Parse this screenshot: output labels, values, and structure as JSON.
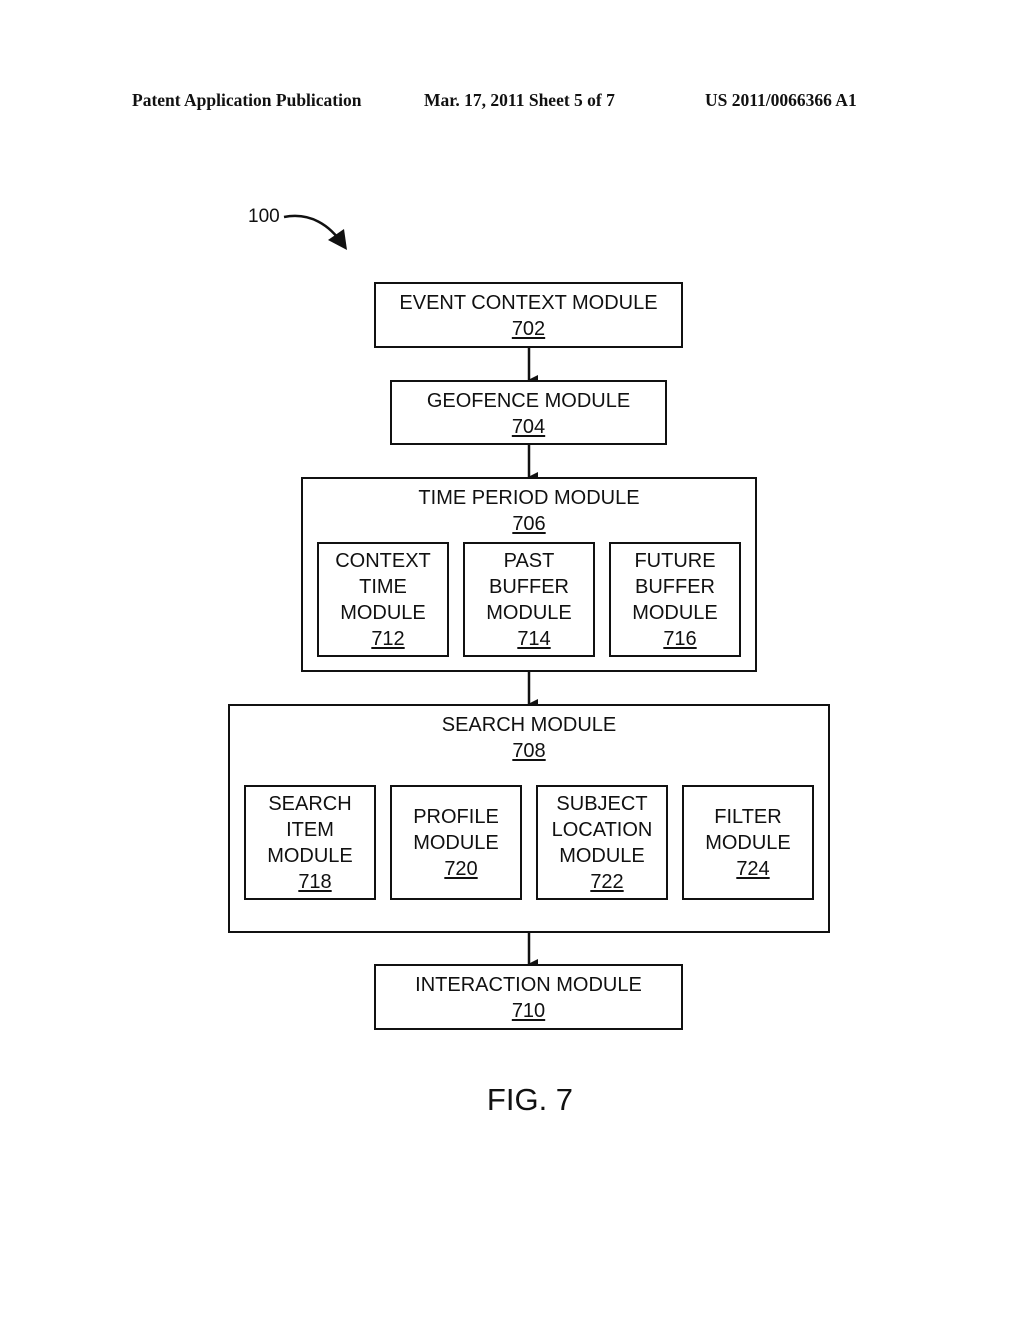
{
  "header": {
    "publication": "Patent Application Publication",
    "date_sheet": "Mar. 17, 2011  Sheet 5 of 7",
    "number": "US 2011/0066366 A1"
  },
  "diagram": {
    "reference": "100",
    "figure_label": "FIG. 7",
    "modules": {
      "event_context": {
        "label": "EVENT CONTEXT MODULE",
        "ref": "702"
      },
      "geofence": {
        "label": "GEOFENCE MODULE",
        "ref": "704"
      },
      "time_period": {
        "label": "TIME PERIOD MODULE",
        "ref": "706",
        "children": [
          {
            "label": "CONTEXT\nTIME\nMODULE",
            "ref": "712"
          },
          {
            "label": "PAST\nBUFFER\nMODULE",
            "ref": "714"
          },
          {
            "label": "FUTURE\nBUFFER\nMODULE",
            "ref": "716"
          }
        ]
      },
      "search": {
        "label": "SEARCH MODULE",
        "ref": "708",
        "children": [
          {
            "label": "SEARCH\nITEM\nMODULE",
            "ref": "718"
          },
          {
            "label": "PROFILE\nMODULE",
            "ref": "720"
          },
          {
            "label": "SUBJECT\nLOCATION\nMODULE",
            "ref": "722"
          },
          {
            "label": "FILTER\nMODULE",
            "ref": "724"
          }
        ]
      },
      "interaction": {
        "label": "INTERACTION MODULE",
        "ref": "710"
      }
    },
    "flow": [
      "702",
      "704",
      "706",
      "708",
      "710"
    ]
  }
}
